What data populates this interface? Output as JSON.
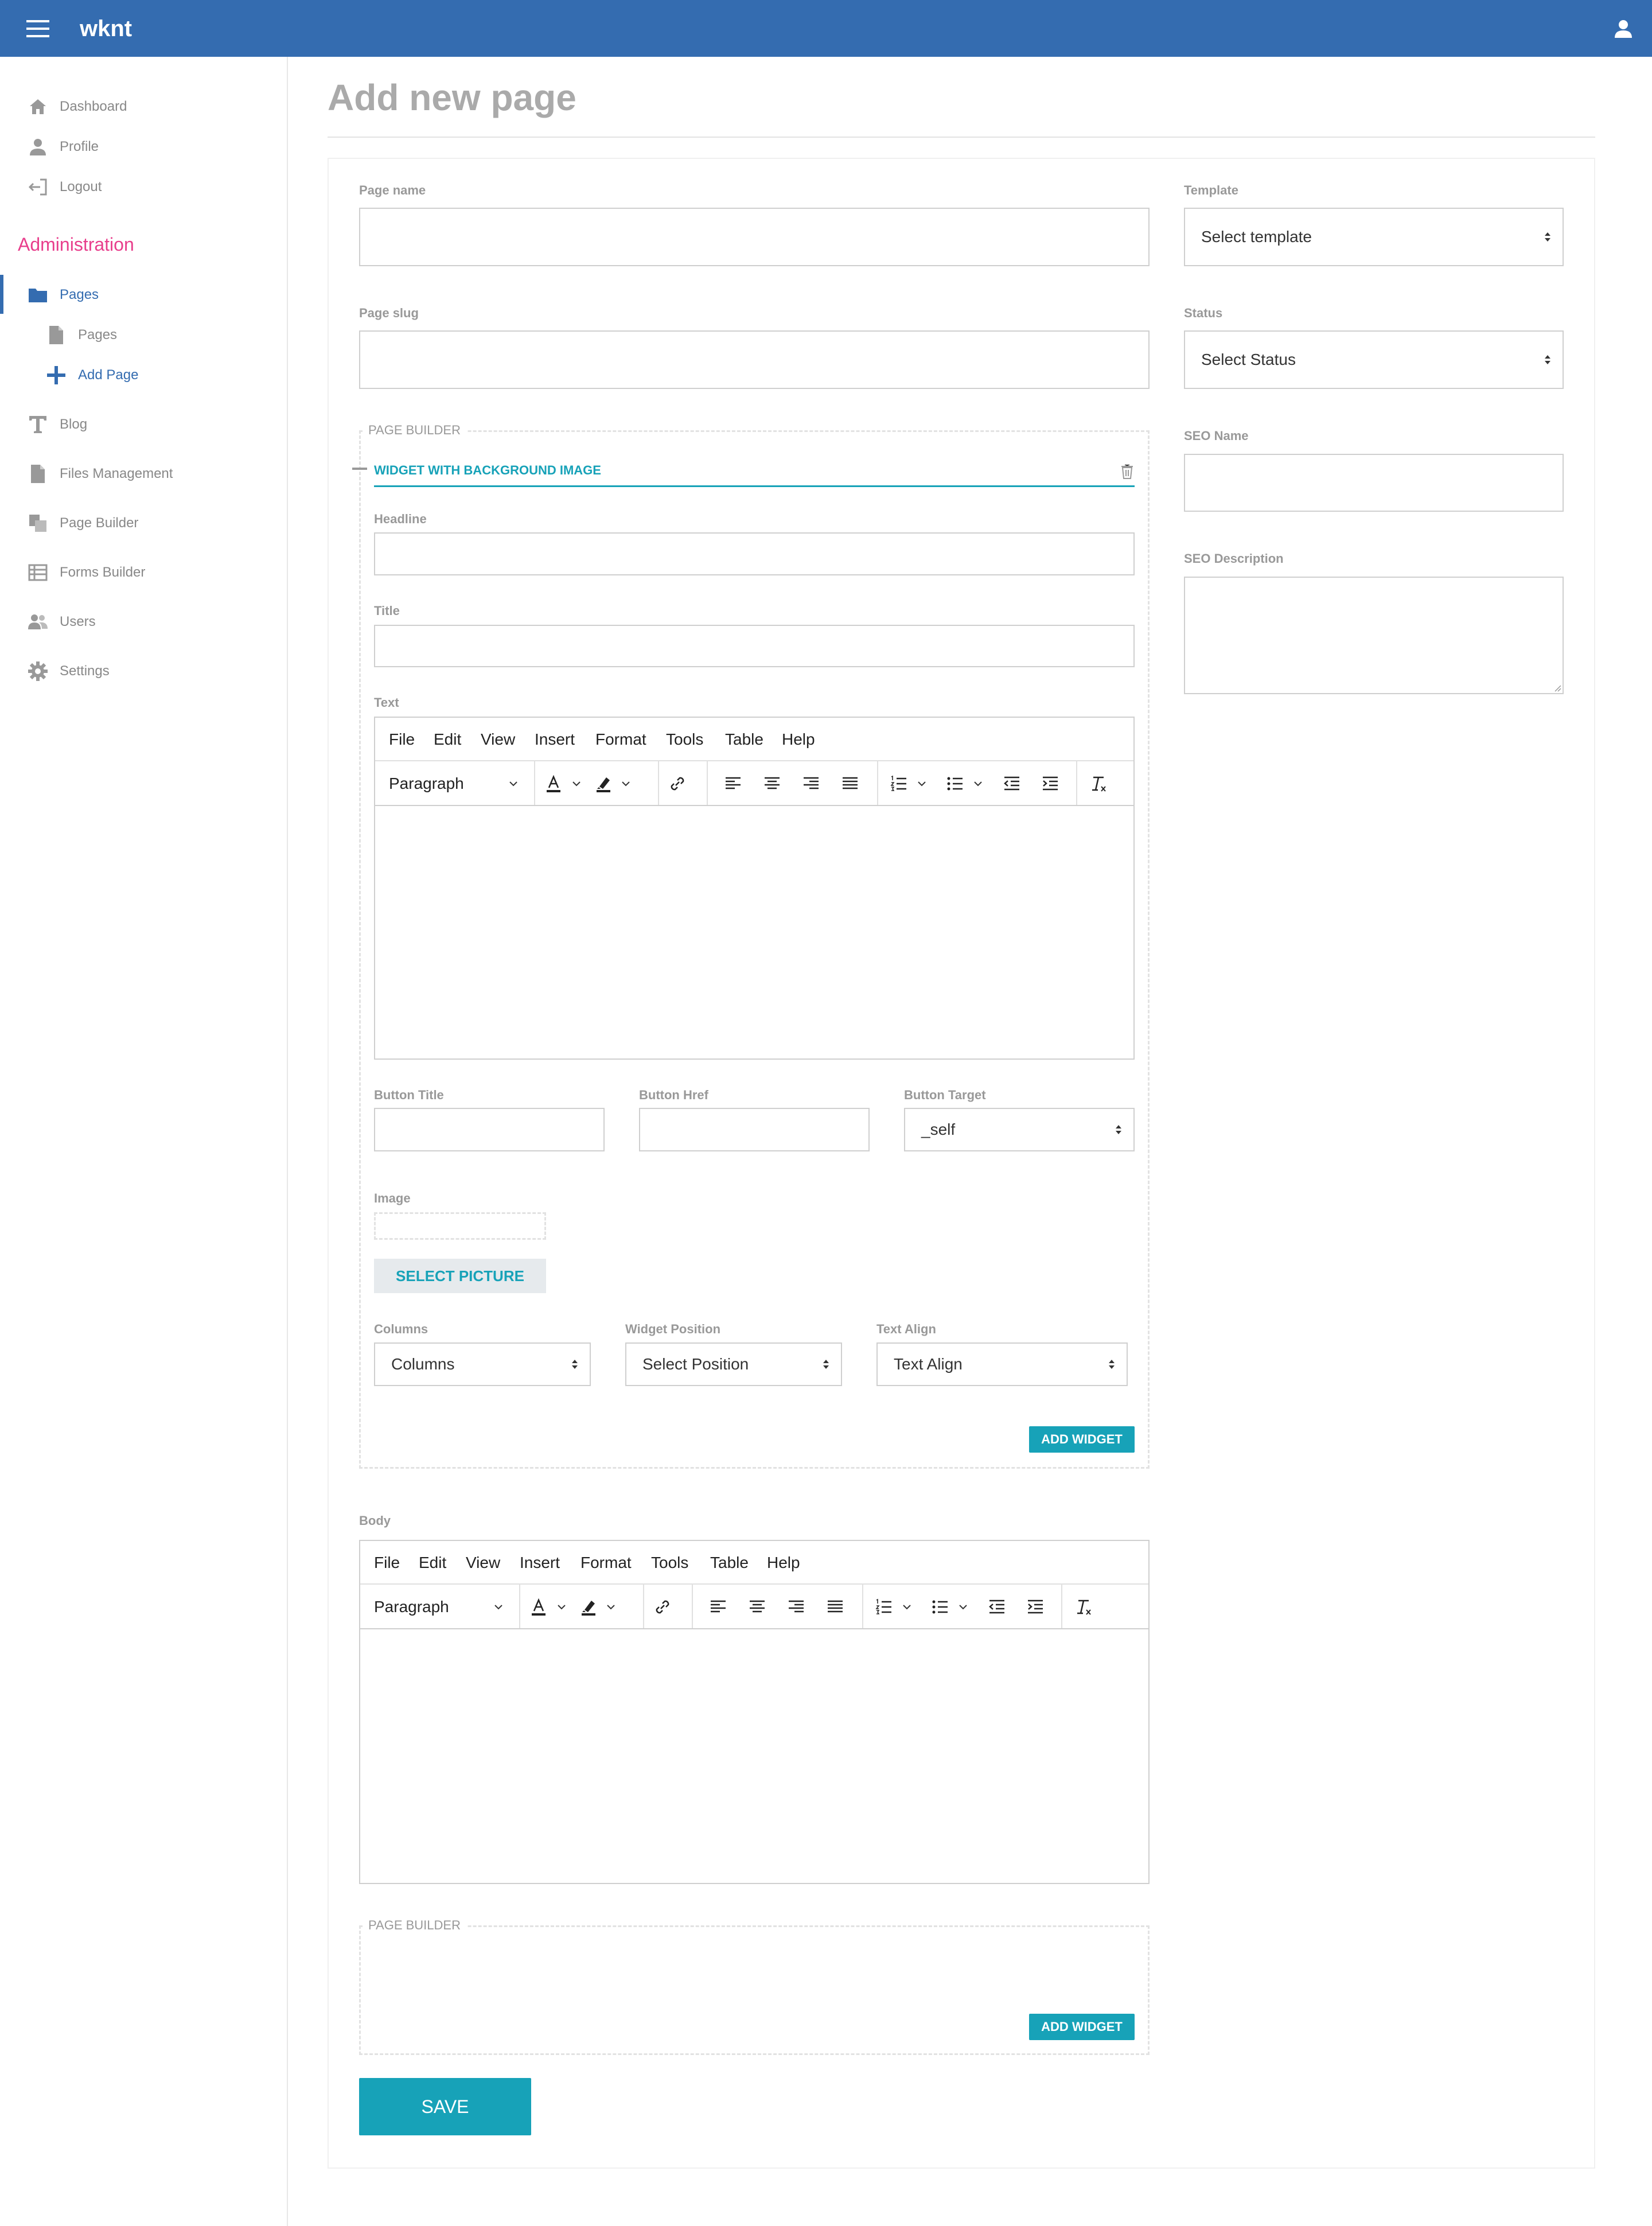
{
  "app": {
    "brand": "wknt"
  },
  "sidebar": {
    "items": [
      {
        "label": "Dashboard",
        "icon": "home-icon"
      },
      {
        "label": "Profile",
        "icon": "person-icon"
      },
      {
        "label": "Logout",
        "icon": "logout-icon"
      }
    ],
    "admin_heading": "Administration",
    "admin_items": [
      {
        "label": "Pages",
        "icon": "folder-icon",
        "active": true
      },
      {
        "label": "Pages",
        "icon": "file-icon"
      },
      {
        "label": "Add Page",
        "icon": "plus-icon",
        "active": true
      },
      {
        "label": "Blog",
        "icon": "text-icon"
      },
      {
        "label": "Files Management",
        "icon": "file-icon"
      },
      {
        "label": "Page Builder",
        "icon": "copy-icon"
      },
      {
        "label": "Forms Builder",
        "icon": "table-icon"
      },
      {
        "label": "Users",
        "icon": "users-icon"
      },
      {
        "label": "Settings",
        "icon": "gear-icon"
      }
    ]
  },
  "main": {
    "title": "Add new page",
    "page_name_label": "Page name",
    "page_slug_label": "Page slug",
    "template_label": "Template",
    "template_value": "Select template",
    "status_label": "Status",
    "status_value": "Select Status",
    "seo_name_label": "SEO Name",
    "seo_desc_label": "SEO Description",
    "page_builder_label": "PAGE BUILDER",
    "widget": {
      "title": "WIDGET WITH BACKGROUND IMAGE",
      "headline_label": "Headline",
      "title_label": "Title",
      "text_label": "Text",
      "button_title_label": "Button Title",
      "button_href_label": "Button Href",
      "button_target_label": "Button Target",
      "button_target_value": "_self",
      "image_label": "Image",
      "select_picture": "SELECT PICTURE",
      "columns_label": "Columns",
      "columns_value": "Columns",
      "widget_position_label": "Widget Position",
      "widget_position_value": "Select Position",
      "text_align_label": "Text Align",
      "text_align_value": "Text Align",
      "add_widget": "ADD WIDGET"
    },
    "editor": {
      "menu": [
        "File",
        "Edit",
        "View",
        "Insert",
        "Format",
        "Tools",
        "Table",
        "Help"
      ],
      "block_format": "Paragraph"
    },
    "body_label": "Body",
    "page_builder2_label": "PAGE BUILDER",
    "add_widget2": "ADD WIDGET",
    "save": "SAVE"
  },
  "colors": {
    "topbar": "#346cb0",
    "accent": "#17a2b8",
    "admin": "#e83e8c"
  }
}
